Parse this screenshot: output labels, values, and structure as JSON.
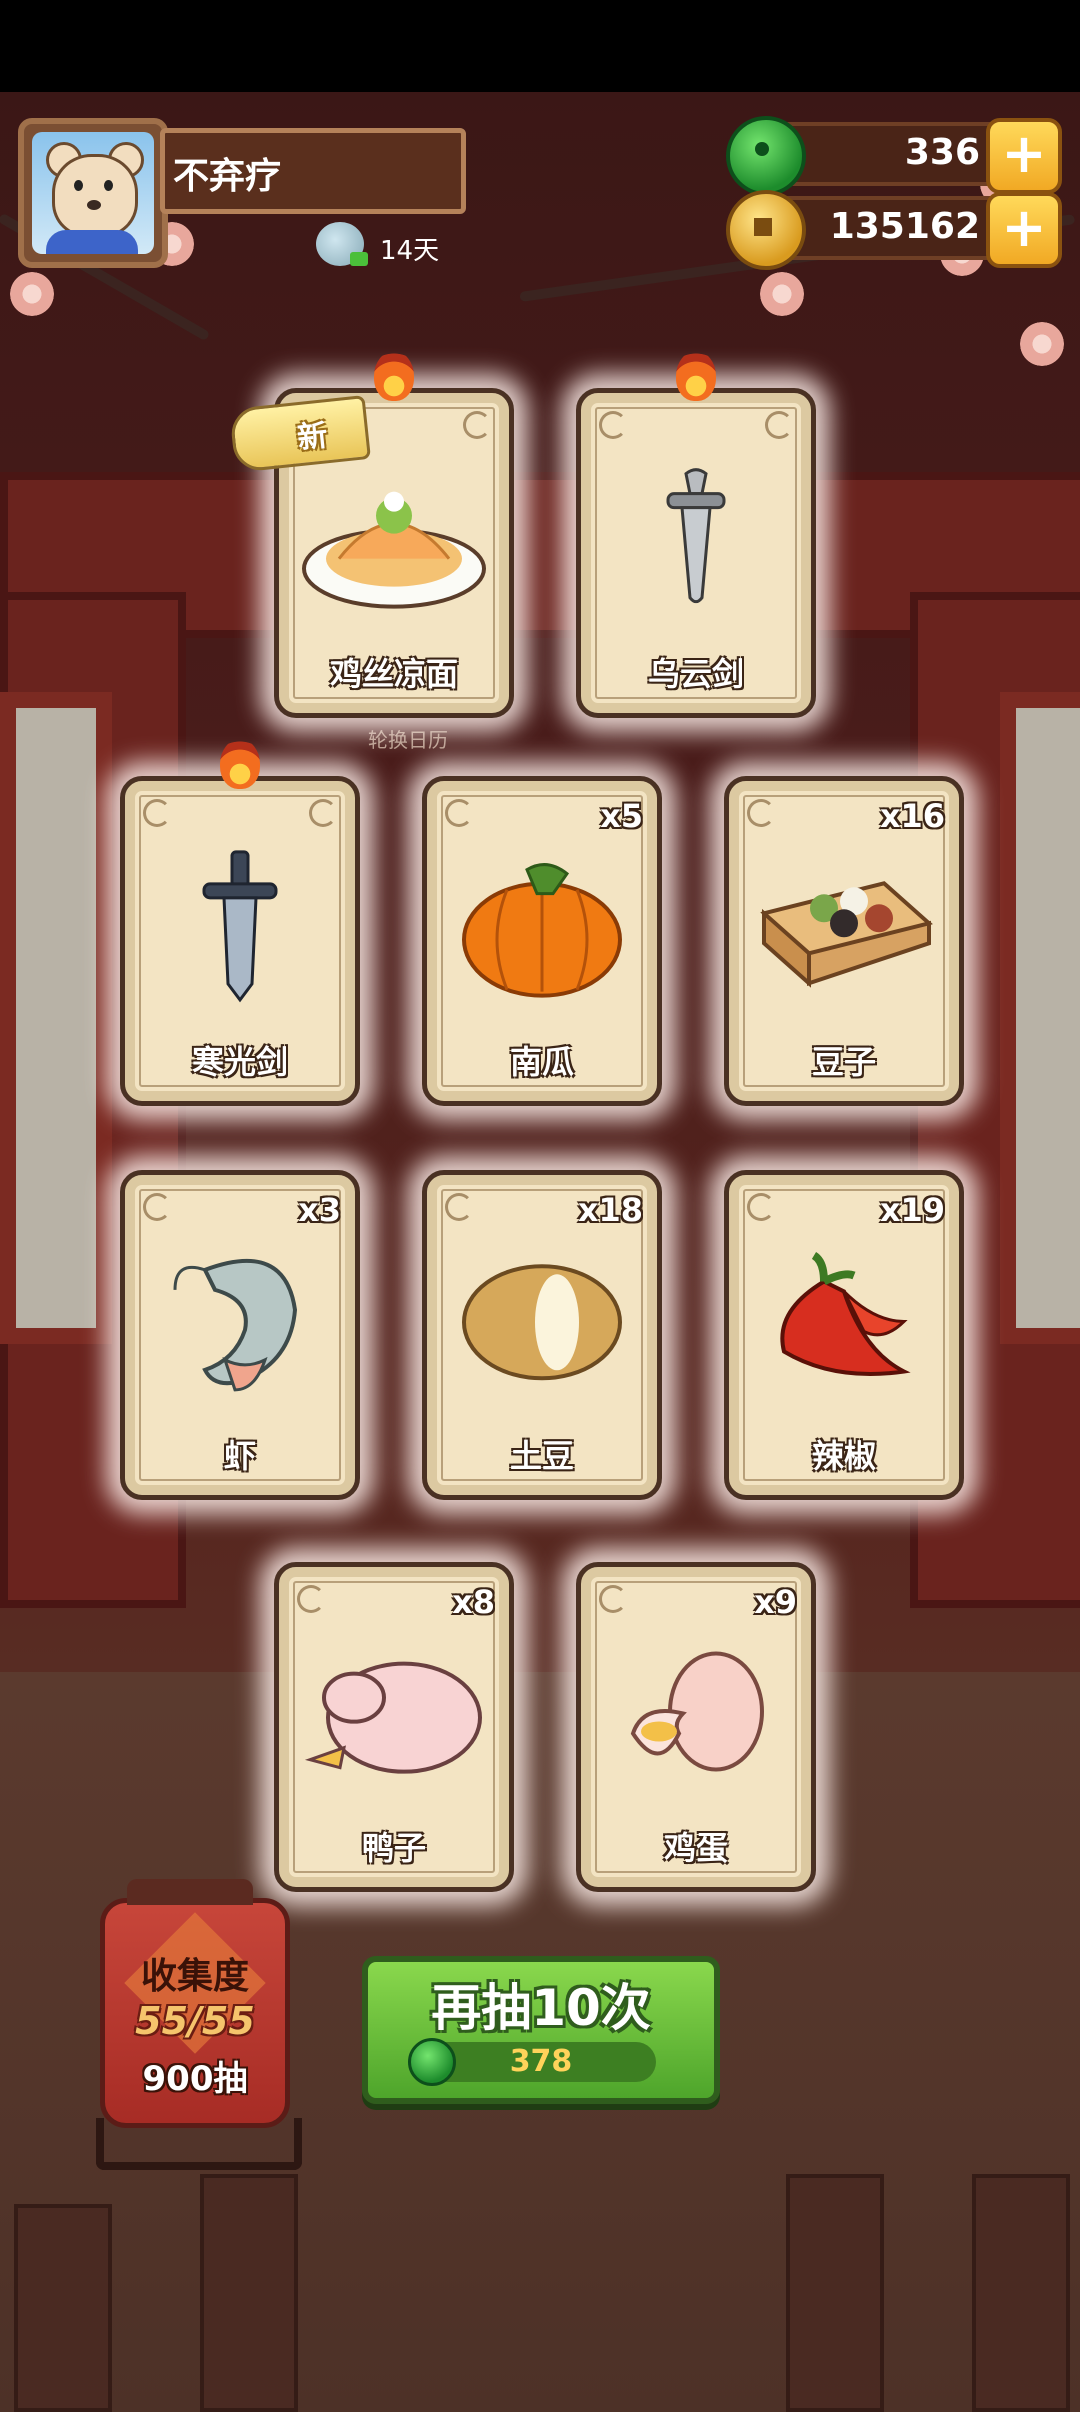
{
  "player": {
    "name": "不弃疗",
    "days": "14天"
  },
  "resources": {
    "jade": "336",
    "coins": "135162"
  },
  "banner": {
    "new_label": "新",
    "rotate_label": "轮换日历"
  },
  "cards": [
    {
      "name": "鸡丝凉面",
      "count": "",
      "hot": true,
      "new": true,
      "icon": "noodle-dish-icon"
    },
    {
      "name": "乌云剑",
      "count": "",
      "hot": true,
      "new": false,
      "icon": "dark-cloud-sword-icon"
    },
    {
      "name": "寒光剑",
      "count": "",
      "hot": true,
      "new": false,
      "icon": "cold-light-sword-icon"
    },
    {
      "name": "南瓜",
      "count": "x5",
      "hot": false,
      "new": false,
      "icon": "pumpkin-icon"
    },
    {
      "name": "豆子",
      "count": "x16",
      "hot": false,
      "new": false,
      "icon": "beans-icon"
    },
    {
      "name": "虾",
      "count": "x3",
      "hot": false,
      "new": false,
      "icon": "shrimp-icon"
    },
    {
      "name": "土豆",
      "count": "x18",
      "hot": false,
      "new": false,
      "icon": "potato-icon"
    },
    {
      "name": "辣椒",
      "count": "x19",
      "hot": false,
      "new": false,
      "icon": "chili-pepper-icon"
    },
    {
      "name": "鸭子",
      "count": "x8",
      "hot": false,
      "new": false,
      "icon": "duck-icon"
    },
    {
      "name": "鸡蛋",
      "count": "x9",
      "hot": false,
      "new": false,
      "icon": "egg-icon"
    }
  ],
  "collection": {
    "title": "收集度",
    "progress": "55/55",
    "draws": "900抽"
  },
  "draw_button": {
    "label": "再抽10次",
    "cost": "378"
  },
  "colors": {
    "card_bg": "#f3e4c3",
    "button_green": "#6cc03a",
    "lantern_red": "#c7463a"
  }
}
